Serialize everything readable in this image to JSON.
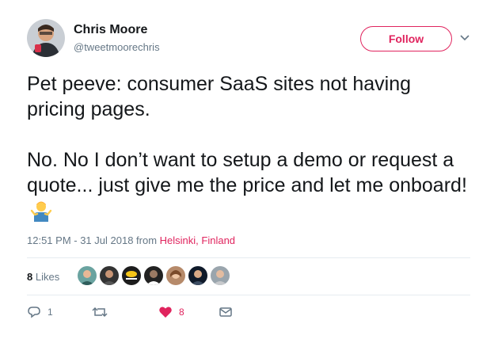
{
  "author": {
    "name": "Chris Moore",
    "handle": "@tweetmoorechris"
  },
  "follow_button": {
    "label": "Follow"
  },
  "tweet": {
    "paragraph1": "Pet peeve: consumer SaaS sites not having pricing pages.",
    "paragraph2": "No. No I don’t want to setup a demo or request a quote... just give me the price and let me onboard!",
    "emoji": "man-shrugging"
  },
  "meta": {
    "timestamp": "12:51 PM - 31 Jul 2018 from",
    "location": "Helsinki, Finland"
  },
  "likes": {
    "count": "8",
    "label": "Likes"
  },
  "actions": {
    "reply_count": "1",
    "like_count": "8"
  },
  "colors": {
    "accent": "#e0245e",
    "muted": "#657786",
    "divider": "#e6ecf0"
  }
}
